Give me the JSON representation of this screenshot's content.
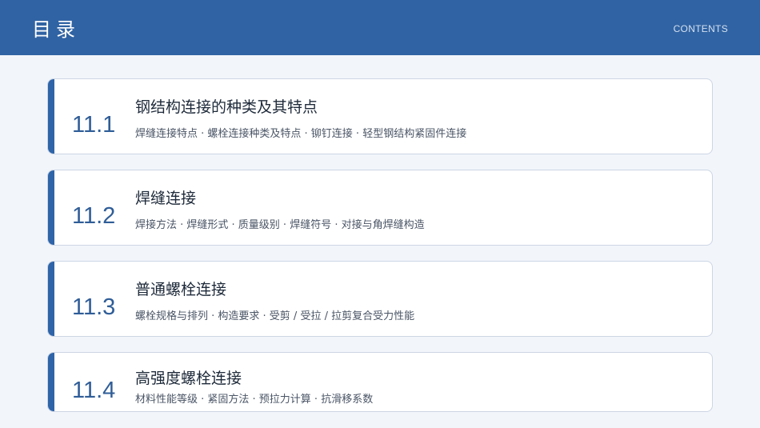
{
  "header": {
    "title": "目录",
    "subtitle": "CONTENTS"
  },
  "sections": [
    {
      "number": "11.1",
      "title": "钢结构连接的种类及其特点",
      "desc": "焊缝连接特点 · 螺栓连接种类及特点 · 铆钉连接 · 轻型钢结构紧固件连接"
    },
    {
      "number": "11.2",
      "title": "焊缝连接",
      "desc": "焊接方法 · 焊缝形式 · 质量级别 · 焊缝符号 · 对接与角焊缝构造"
    },
    {
      "number": "11.3",
      "title": "普通螺栓连接",
      "desc": "螺栓规格与排列 · 构造要求 · 受剪 / 受拉 / 拉剪复合受力性能"
    },
    {
      "number": "11.4",
      "title": "高强度螺栓连接",
      "desc": "材料性能等级 · 紧固方法 · 预拉力计算 · 抗滑移系数"
    }
  ]
}
